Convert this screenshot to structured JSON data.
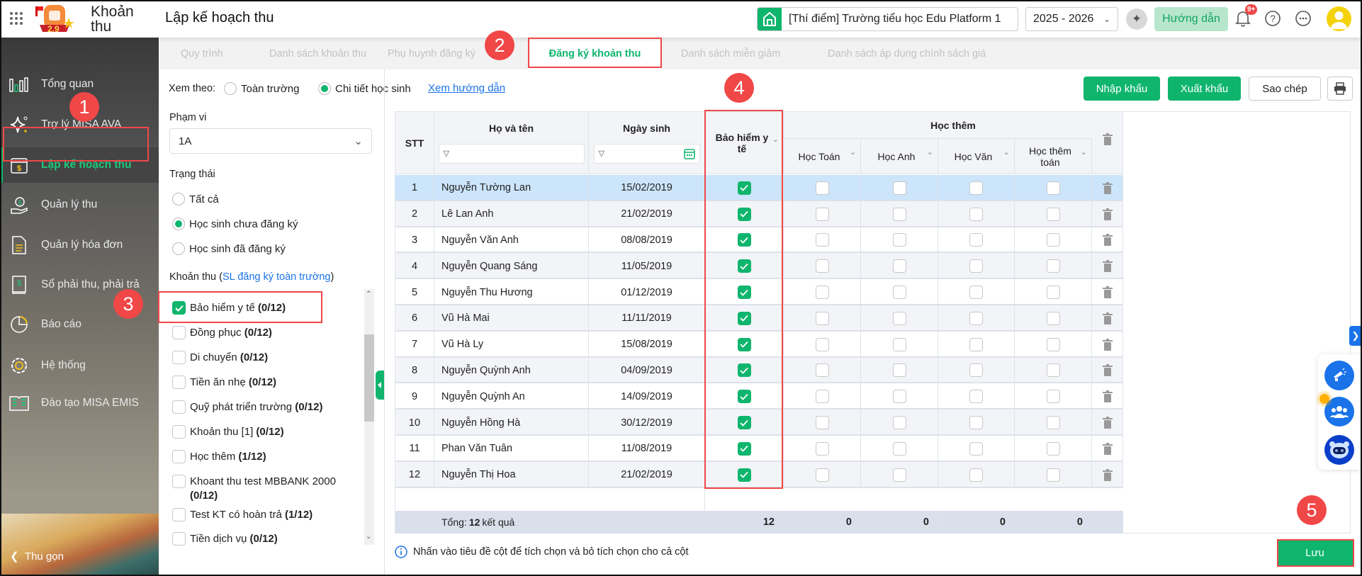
{
  "header": {
    "app_name_line1": "Khoản",
    "app_name_line2": "thu",
    "logo_text": "2.9",
    "page_title": "Lập kế hoạch thu",
    "school": "[Thí điểm] Trường tiểu học Edu Platform 1",
    "year": "2025 - 2026",
    "guide_label": "Hướng dẫn",
    "notification_badge": "9+"
  },
  "sidebar": {
    "items": [
      {
        "label": "Tổng quan",
        "icon": "chart-bars-icon"
      },
      {
        "label": "Trợ lý MISA AVA",
        "icon": "sparkle-icon"
      },
      {
        "label": "Lập kế hoạch thu",
        "icon": "calendar-dollar-icon"
      },
      {
        "label": "Quản lý thu",
        "icon": "hand-coin-icon"
      },
      {
        "label": "Quản lý hóa đơn",
        "icon": "invoice-icon"
      },
      {
        "label": "Sổ phải thu, phải trả",
        "icon": "ledger-icon"
      },
      {
        "label": "Báo cáo",
        "icon": "pie-chart-icon"
      },
      {
        "label": "Hệ thống",
        "icon": "gear-icon"
      },
      {
        "label": "Đào tạo MISA EMIS",
        "icon": "book-icon"
      }
    ],
    "collapse_label": "Thu gọn"
  },
  "tabs": [
    {
      "label": "Quy trình"
    },
    {
      "label": "Danh sách khoản thu"
    },
    {
      "label": "Phụ huynh đăng ký"
    },
    {
      "label": "Đăng ký khoản thu"
    },
    {
      "label": "Danh sách miễn giảm"
    },
    {
      "label": "Danh sách áp dụng chính sách giá"
    }
  ],
  "toolbar": {
    "view_label": "Xem theo:",
    "view_options": [
      "Toàn trường",
      "Chi tiết học sinh"
    ],
    "guide_link": "Xem hướng dẫn",
    "import": "Nhập khẩu",
    "export": "Xuất khẩu",
    "copy": "Sao chép"
  },
  "filter": {
    "scope_label": "Phạm vi",
    "scope_value": "1A",
    "status_label": "Trạng thái",
    "status_options": [
      "Tất cả",
      "Học sinh chưa đăng ký",
      "Học sinh đã đăng ký"
    ],
    "fees_label": "Khoản thu (",
    "fees_link": "SL đăng ký toàn trường",
    "fees_label_end": ")",
    "fees": [
      {
        "name": "Bảo hiểm y tế",
        "count": "(0/12)",
        "checked": true
      },
      {
        "name": "Đồng phục",
        "count": "(0/12)",
        "checked": false
      },
      {
        "name": "Di chuyển",
        "count": "(0/12)",
        "checked": false
      },
      {
        "name": "Tiền ăn nhẹ",
        "count": "(0/12)",
        "checked": false
      },
      {
        "name": "Quỹ phát triển trường",
        "count": "(0/12)",
        "checked": false
      },
      {
        "name": "Khoản thu [1]",
        "count": "(0/12)",
        "checked": false
      },
      {
        "name": "Học thêm",
        "count": "(1/12)",
        "checked": false
      },
      {
        "name": "Khoant thu test MBBANK 2000",
        "count": "(0/12)",
        "checked": false
      },
      {
        "name": "Test KT có hoàn trả",
        "count": "(1/12)",
        "checked": false
      },
      {
        "name": "Tiền dịch vụ",
        "count": "(0/12)",
        "checked": false
      }
    ]
  },
  "table": {
    "headers": {
      "stt": "STT",
      "name": "Họ và tên",
      "dob": "Ngày sinh",
      "bhyt": "Bảo hiểm y tế",
      "group": "Học thêm",
      "sub": [
        "Học Toán",
        "Học Anh",
        "Học Văn",
        "Học thêm toán"
      ]
    },
    "rows": [
      {
        "stt": "1",
        "name": "Nguyễn Tường Lan",
        "dob": "15/02/2019",
        "bhyt": true,
        "sub": [
          false,
          false,
          false,
          false
        ]
      },
      {
        "stt": "2",
        "name": "Lê Lan Anh",
        "dob": "21/02/2019",
        "bhyt": true,
        "sub": [
          false,
          false,
          false,
          false
        ]
      },
      {
        "stt": "3",
        "name": "Nguyễn Văn Anh",
        "dob": "08/08/2019",
        "bhyt": true,
        "sub": [
          false,
          false,
          false,
          false
        ]
      },
      {
        "stt": "4",
        "name": "Nguyễn Quang Sáng",
        "dob": "11/05/2019",
        "bhyt": true,
        "sub": [
          false,
          false,
          false,
          false
        ]
      },
      {
        "stt": "5",
        "name": "Nguyễn Thu Hương",
        "dob": "01/12/2019",
        "bhyt": true,
        "sub": [
          false,
          false,
          false,
          false
        ]
      },
      {
        "stt": "6",
        "name": "Vũ Hà Mai",
        "dob": "11/11/2019",
        "bhyt": true,
        "sub": [
          false,
          false,
          false,
          false
        ]
      },
      {
        "stt": "7",
        "name": "Vũ Hà Ly",
        "dob": "15/08/2019",
        "bhyt": true,
        "sub": [
          false,
          false,
          false,
          false
        ]
      },
      {
        "stt": "8",
        "name": "Nguyễn Quỳnh Anh",
        "dob": "04/09/2019",
        "bhyt": true,
        "sub": [
          false,
          false,
          false,
          false
        ]
      },
      {
        "stt": "9",
        "name": "Nguyễn Quỳnh An",
        "dob": "14/09/2019",
        "bhyt": true,
        "sub": [
          false,
          false,
          false,
          false
        ]
      },
      {
        "stt": "10",
        "name": "Nguyễn Hồng Hà",
        "dob": "30/12/2019",
        "bhyt": true,
        "sub": [
          false,
          false,
          false,
          false
        ]
      },
      {
        "stt": "11",
        "name": "Phan Văn Tuân",
        "dob": "11/08/2019",
        "bhyt": true,
        "sub": [
          false,
          false,
          false,
          false
        ]
      },
      {
        "stt": "12",
        "name": "Nguyễn Thị Hoa",
        "dob": "21/02/2019",
        "bhyt": true,
        "sub": [
          false,
          false,
          false,
          false
        ]
      }
    ],
    "total_prefix": "Tổng: ",
    "total_count": "12",
    "total_suffix": " kết quả",
    "totals": [
      "12",
      "0",
      "0",
      "0",
      "0"
    ]
  },
  "footer": {
    "hint": "Nhấn vào tiêu đề cột để tích chọn và bỏ tích chọn cho cả cột",
    "save": "Lưu"
  },
  "annotations": [
    "1",
    "2",
    "3",
    "4",
    "5"
  ],
  "colors": {
    "accent": "#0fb56d",
    "highlight": "#f04747",
    "link": "#1a73e8",
    "selected_row": "#cce5fb"
  }
}
